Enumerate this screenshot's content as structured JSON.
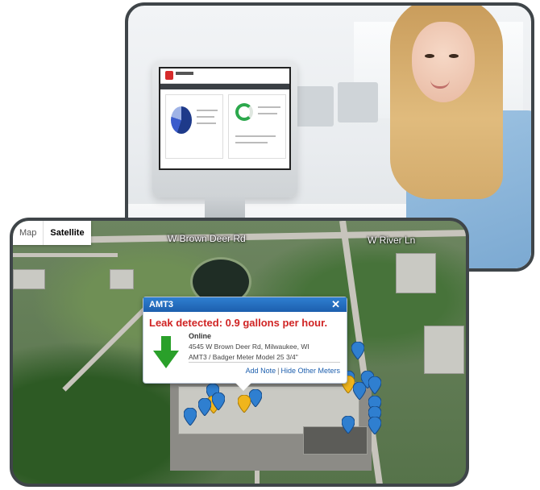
{
  "map": {
    "toggle": {
      "map_label": "Map",
      "satellite_label": "Satellite"
    },
    "roads": {
      "road_1": "Rd",
      "road_2": "W Brown Deer Rd",
      "road_3": "W River Ln"
    },
    "popup": {
      "title": "AMT3",
      "close_symbol": "✕",
      "alert": "Leak detected: 0.9 gallons per hour.",
      "status": "Online",
      "address": "4545 W Brown Deer Rd, Milwaukee, WI",
      "meter": "AMT3 / Badger Meter Model 25 3/4\"",
      "add_note_label": "Add Note",
      "separator": "|",
      "hide_meters_label": "Hide Other Meters",
      "status_icon": "down-arrow-icon"
    },
    "marker_colors": {
      "blue": "#2f7fd0",
      "yellow": "#f0b51c"
    }
  },
  "colors": {
    "alert_red": "#d02424",
    "arrow_green": "#2aa02a",
    "header_blue": "#1d5fae"
  }
}
